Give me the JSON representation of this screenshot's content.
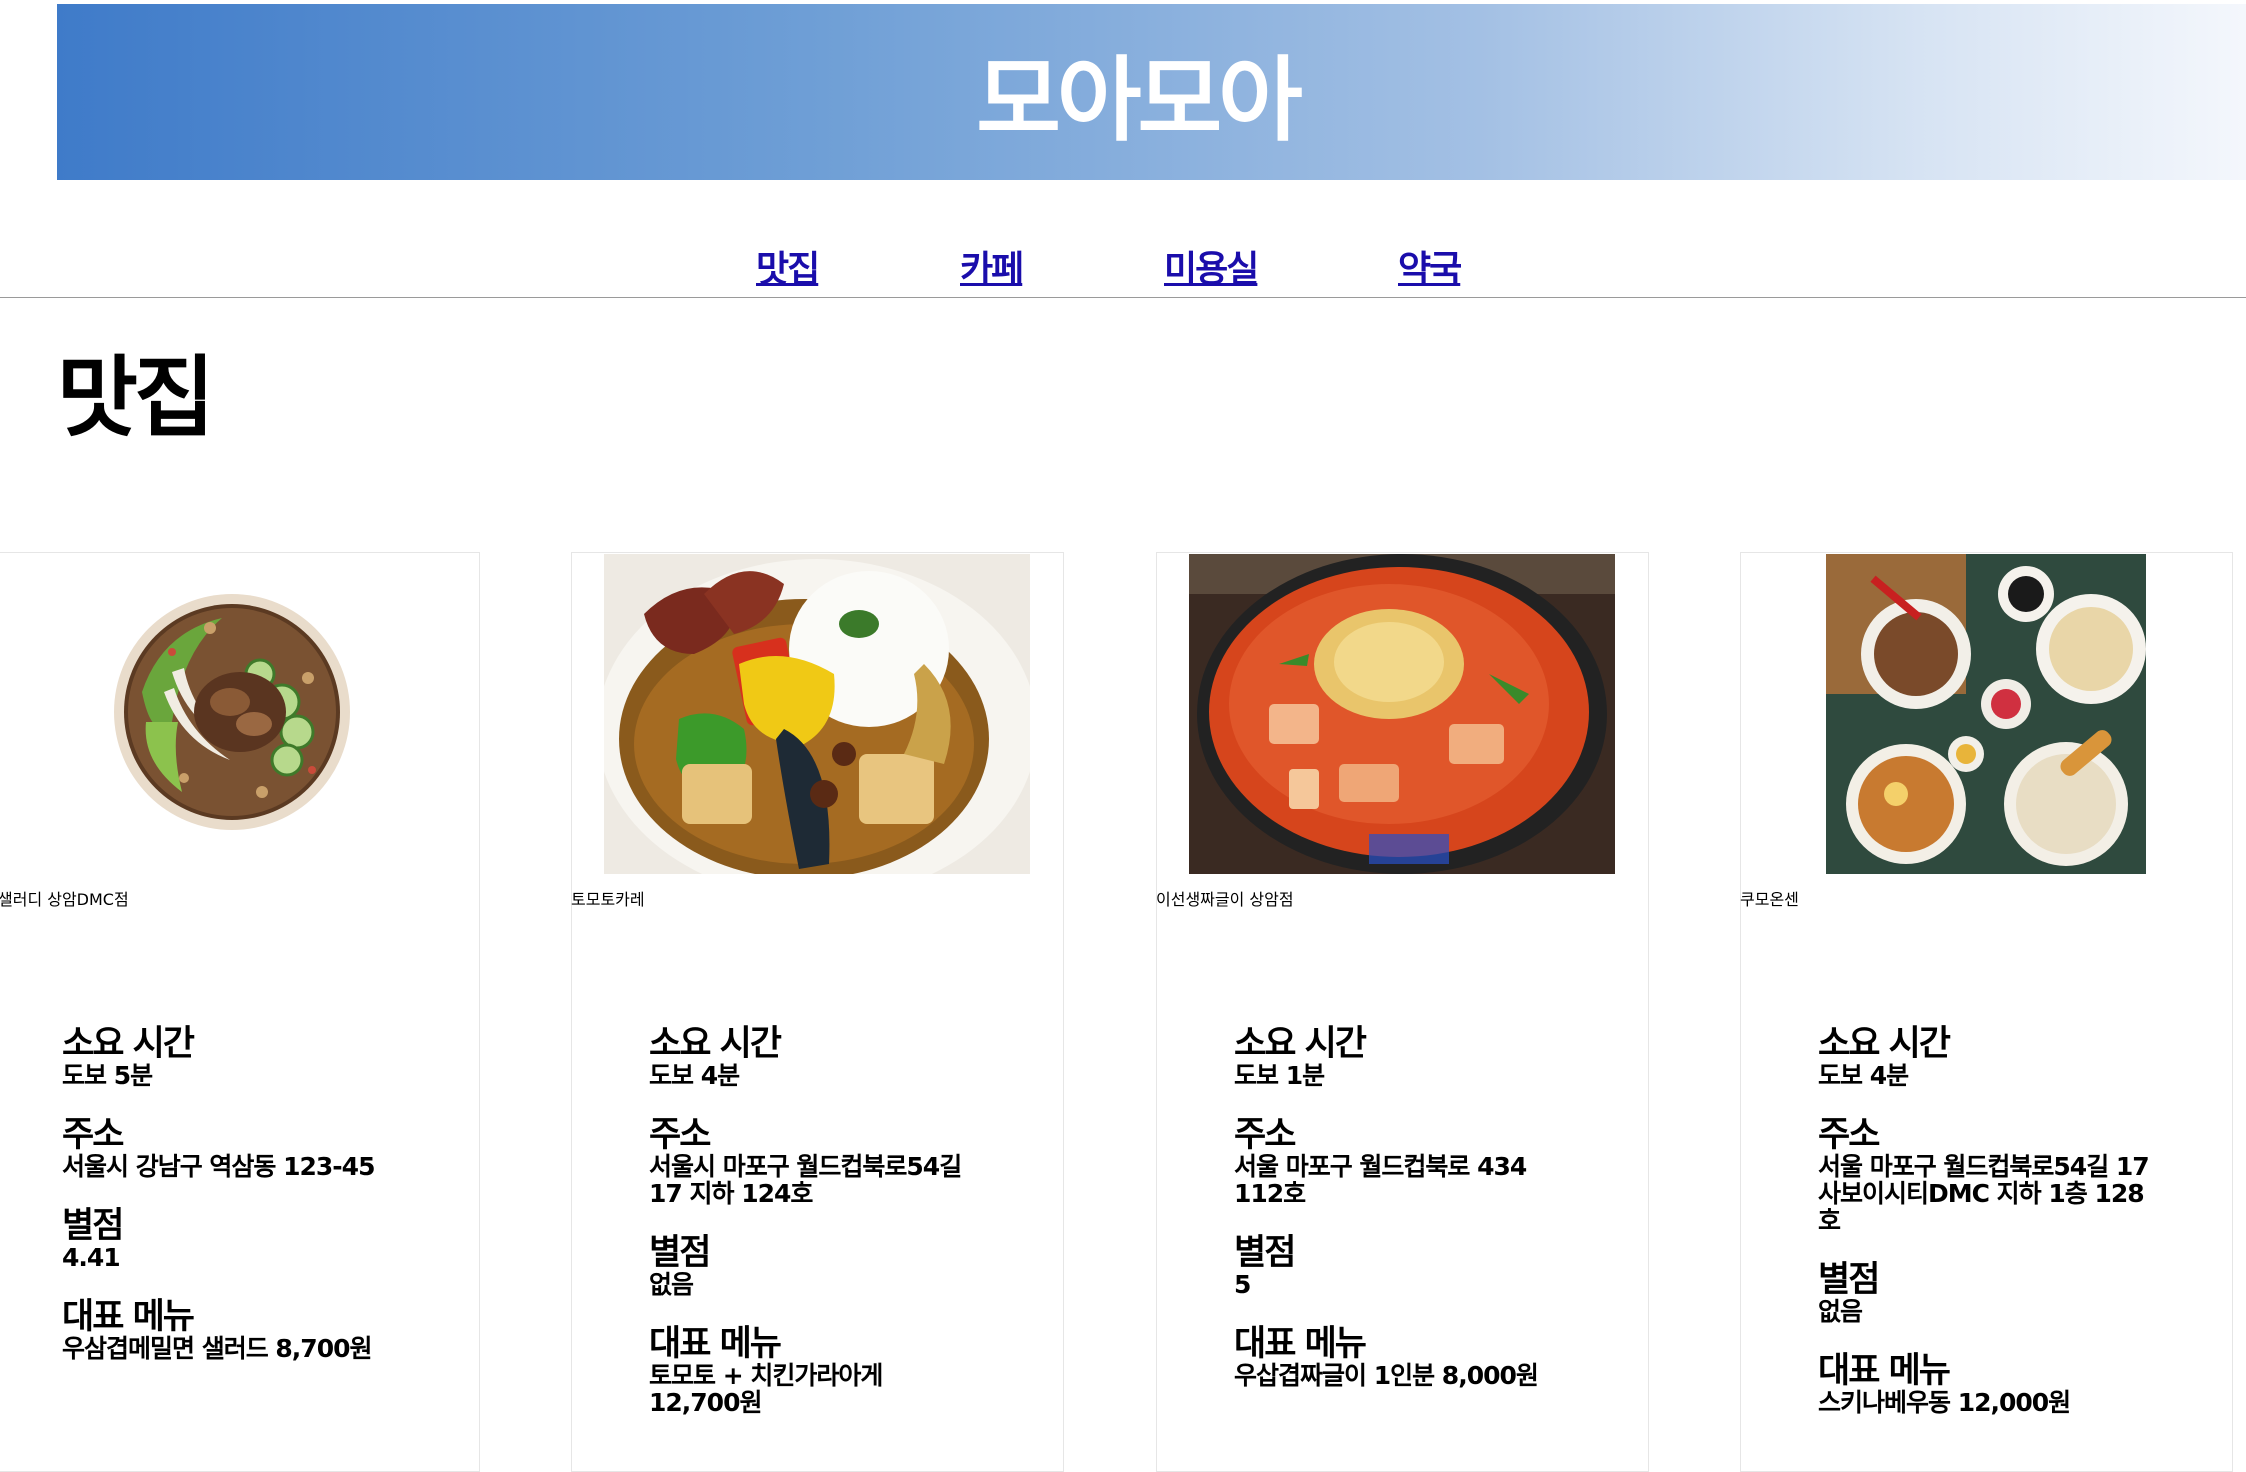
{
  "header": {
    "title": "모아모아"
  },
  "nav": {
    "items": [
      {
        "label": "맛집"
      },
      {
        "label": "카페"
      },
      {
        "label": "미용실"
      },
      {
        "label": "약국"
      }
    ]
  },
  "section": {
    "title": "맛집"
  },
  "labels": {
    "time": "소요 시간",
    "address": "주소",
    "rating": "별점",
    "menu": "대표 메뉴"
  },
  "restaurants": [
    {
      "name": "샐러디 상암DMC점",
      "time": "도보 5분",
      "address": "서울시 강남구 역삼동 123-45",
      "rating": "4.41",
      "menu": "우삼겹메밀면 샐러드 8,700원",
      "image": "salad-bowl-photo"
    },
    {
      "name": "토모토카레",
      "time": "도보 4분",
      "address": "서울시 마포구 월드컵북로54길 17 지하 124호",
      "rating": "없음",
      "menu": "토모토 + 치킨가라아게 12,700원",
      "image": "curry-rice-photo"
    },
    {
      "name": "이선생짜글이 상암점",
      "time": "도보 1분",
      "address": "서울 마포구 월드컵북로 434 112호",
      "rating": "5",
      "menu": "우삽겹짜글이 1인분 8,000원",
      "image": "jjageuli-stew-photo"
    },
    {
      "name": "쿠모온센",
      "time": "도보 4분",
      "address": "서울 마포구 월드컵북로54길 17 사보이시티DMC 지하 1층 128호",
      "rating": "없음",
      "menu": "스키나베우동 12,000원",
      "image": "udon-spread-photo"
    }
  ]
}
